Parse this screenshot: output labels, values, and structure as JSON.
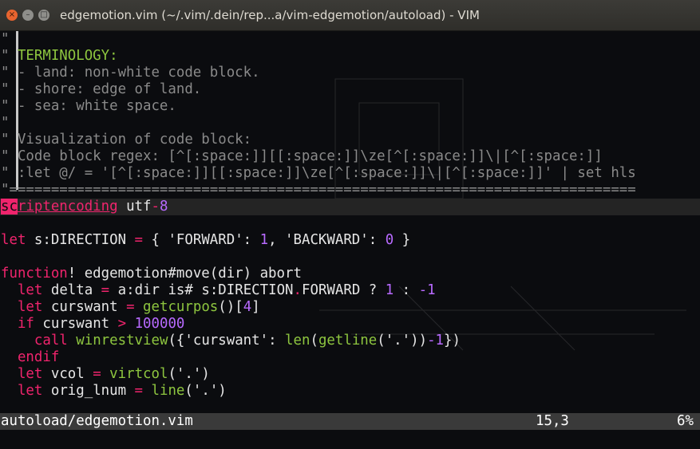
{
  "window": {
    "title": "edgemotion.vim (~/.vim/.dein/rep...a/vim-edgemotion/autoload) - VIM",
    "buttons": {
      "close": "×",
      "minimize": "–",
      "maximize": "□"
    }
  },
  "buffer": {
    "lines": [
      [
        {
          "t": "\"",
          "c": "c"
        }
      ],
      [
        {
          "t": "\" ",
          "c": "c"
        },
        {
          "t": "TERMINOLOGY:",
          "c": "hl"
        }
      ],
      [
        {
          "t": "\" - land: non-white code block.",
          "c": "c"
        }
      ],
      [
        {
          "t": "\" - shore: edge of land.",
          "c": "c"
        }
      ],
      [
        {
          "t": "\" - sea: white space.",
          "c": "c"
        }
      ],
      [
        {
          "t": "\"",
          "c": "c"
        }
      ],
      [
        {
          "t": "\" Visualization of code block:",
          "c": "c"
        }
      ],
      [
        {
          "t": "\" Code block regex: [^[:space:]][[:space:]]\\ze[^[:space:]]\\|[^[:space:]]",
          "c": "c"
        }
      ],
      [
        {
          "t": "\" :let @/ = '[^[:space:]][[:space:]]\\ze[^[:space:]]\\|[^[:space:]]' | set hls",
          "c": "c"
        }
      ],
      [
        {
          "t": "\"===========================================================================",
          "c": "sep"
        }
      ],
      [
        {
          "t": "sc",
          "c": "kw cursor"
        },
        {
          "t": "riptencoding",
          "c": "kw under"
        },
        {
          "t": " utf",
          "c": "tx"
        },
        {
          "t": "-",
          "c": "op"
        },
        {
          "t": "8",
          "c": "num"
        }
      ],
      [],
      [
        {
          "t": "let",
          "c": "kw"
        },
        {
          "t": " s:DIRECTION ",
          "c": "tx"
        },
        {
          "t": "=",
          "c": "op"
        },
        {
          "t": " { 'FORWARD': ",
          "c": "tx"
        },
        {
          "t": "1",
          "c": "num"
        },
        {
          "t": ", 'BACKWARD': ",
          "c": "tx"
        },
        {
          "t": "0",
          "c": "num"
        },
        {
          "t": " }",
          "c": "tx"
        }
      ],
      [],
      [
        {
          "t": "function",
          "c": "kw"
        },
        {
          "t": "! edgemotion#move(dir) abort",
          "c": "tx"
        }
      ],
      [
        {
          "t": "  ",
          "c": "tx"
        },
        {
          "t": "let",
          "c": "kw"
        },
        {
          "t": " delta ",
          "c": "tx"
        },
        {
          "t": "=",
          "c": "op"
        },
        {
          "t": " a:dir ",
          "c": "tx"
        },
        {
          "t": "is#",
          "c": "tx"
        },
        {
          "t": " s:DIRECTION",
          "c": "tx"
        },
        {
          "t": ".",
          "c": "op"
        },
        {
          "t": "FORWARD ? ",
          "c": "tx"
        },
        {
          "t": "1",
          "c": "num"
        },
        {
          "t": " : ",
          "c": "tx"
        },
        {
          "t": "-1",
          "c": "num"
        }
      ],
      [
        {
          "t": "  ",
          "c": "tx"
        },
        {
          "t": "let",
          "c": "kw"
        },
        {
          "t": " curswant ",
          "c": "tx"
        },
        {
          "t": "=",
          "c": "op"
        },
        {
          "t": " ",
          "c": "tx"
        },
        {
          "t": "getcurpos",
          "c": "fn"
        },
        {
          "t": "()[",
          "c": "tx"
        },
        {
          "t": "4",
          "c": "num"
        },
        {
          "t": "]",
          "c": "tx"
        }
      ],
      [
        {
          "t": "  ",
          "c": "tx"
        },
        {
          "t": "if",
          "c": "kw"
        },
        {
          "t": " curswant ",
          "c": "tx"
        },
        {
          "t": ">",
          "c": "op"
        },
        {
          "t": " ",
          "c": "tx"
        },
        {
          "t": "100000",
          "c": "num"
        }
      ],
      [
        {
          "t": "    ",
          "c": "tx"
        },
        {
          "t": "call",
          "c": "kw"
        },
        {
          "t": " ",
          "c": "tx"
        },
        {
          "t": "winrestview",
          "c": "fn"
        },
        {
          "t": "({'curswant': ",
          "c": "tx"
        },
        {
          "t": "len",
          "c": "fn"
        },
        {
          "t": "(",
          "c": "tx"
        },
        {
          "t": "getline",
          "c": "fn"
        },
        {
          "t": "('.'))",
          "c": "tx"
        },
        {
          "t": "-1",
          "c": "num"
        },
        {
          "t": "})",
          "c": "tx"
        }
      ],
      [
        {
          "t": "  ",
          "c": "tx"
        },
        {
          "t": "endif",
          "c": "kw"
        }
      ],
      [
        {
          "t": "  ",
          "c": "tx"
        },
        {
          "t": "let",
          "c": "kw"
        },
        {
          "t": " vcol ",
          "c": "tx"
        },
        {
          "t": "=",
          "c": "op"
        },
        {
          "t": " ",
          "c": "tx"
        },
        {
          "t": "virtcol",
          "c": "fn"
        },
        {
          "t": "('.')",
          "c": "tx"
        }
      ],
      [
        {
          "t": "  ",
          "c": "tx"
        },
        {
          "t": "let",
          "c": "kw"
        },
        {
          "t": " orig_lnum ",
          "c": "tx"
        },
        {
          "t": "=",
          "c": "op"
        },
        {
          "t": " ",
          "c": "tx"
        },
        {
          "t": "line",
          "c": "fn"
        },
        {
          "t": "('.')",
          "c": "tx"
        }
      ],
      []
    ],
    "cursor_line_index": 10
  },
  "statusline": {
    "filename": "autoload/edgemotion.vim",
    "position": "15,3",
    "percent": "6%"
  }
}
